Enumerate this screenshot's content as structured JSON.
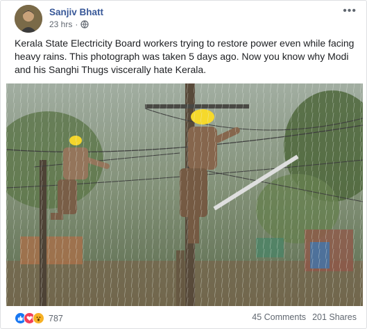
{
  "post": {
    "author": "Sanjiv Bhatt",
    "time": "23 hrs",
    "privacy_icon": "globe-icon",
    "more_icon": "ellipsis-icon",
    "text": "Kerala State Electricity Board workers trying to restore power even while facing heavy rains. This photograph was taken 5 days ago. Now you know why Modi and his Sanghi Thugs viscerally hate Kerala."
  },
  "footer": {
    "reaction_icons": [
      "like-icon",
      "love-icon",
      "wow-icon"
    ],
    "reaction_count": "787",
    "comments": "45 Comments",
    "shares": "201 Shares"
  },
  "colors": {
    "author_link": "#385898",
    "like": "#1877f2",
    "love": "#f33e58",
    "wow": "#f7b125"
  }
}
